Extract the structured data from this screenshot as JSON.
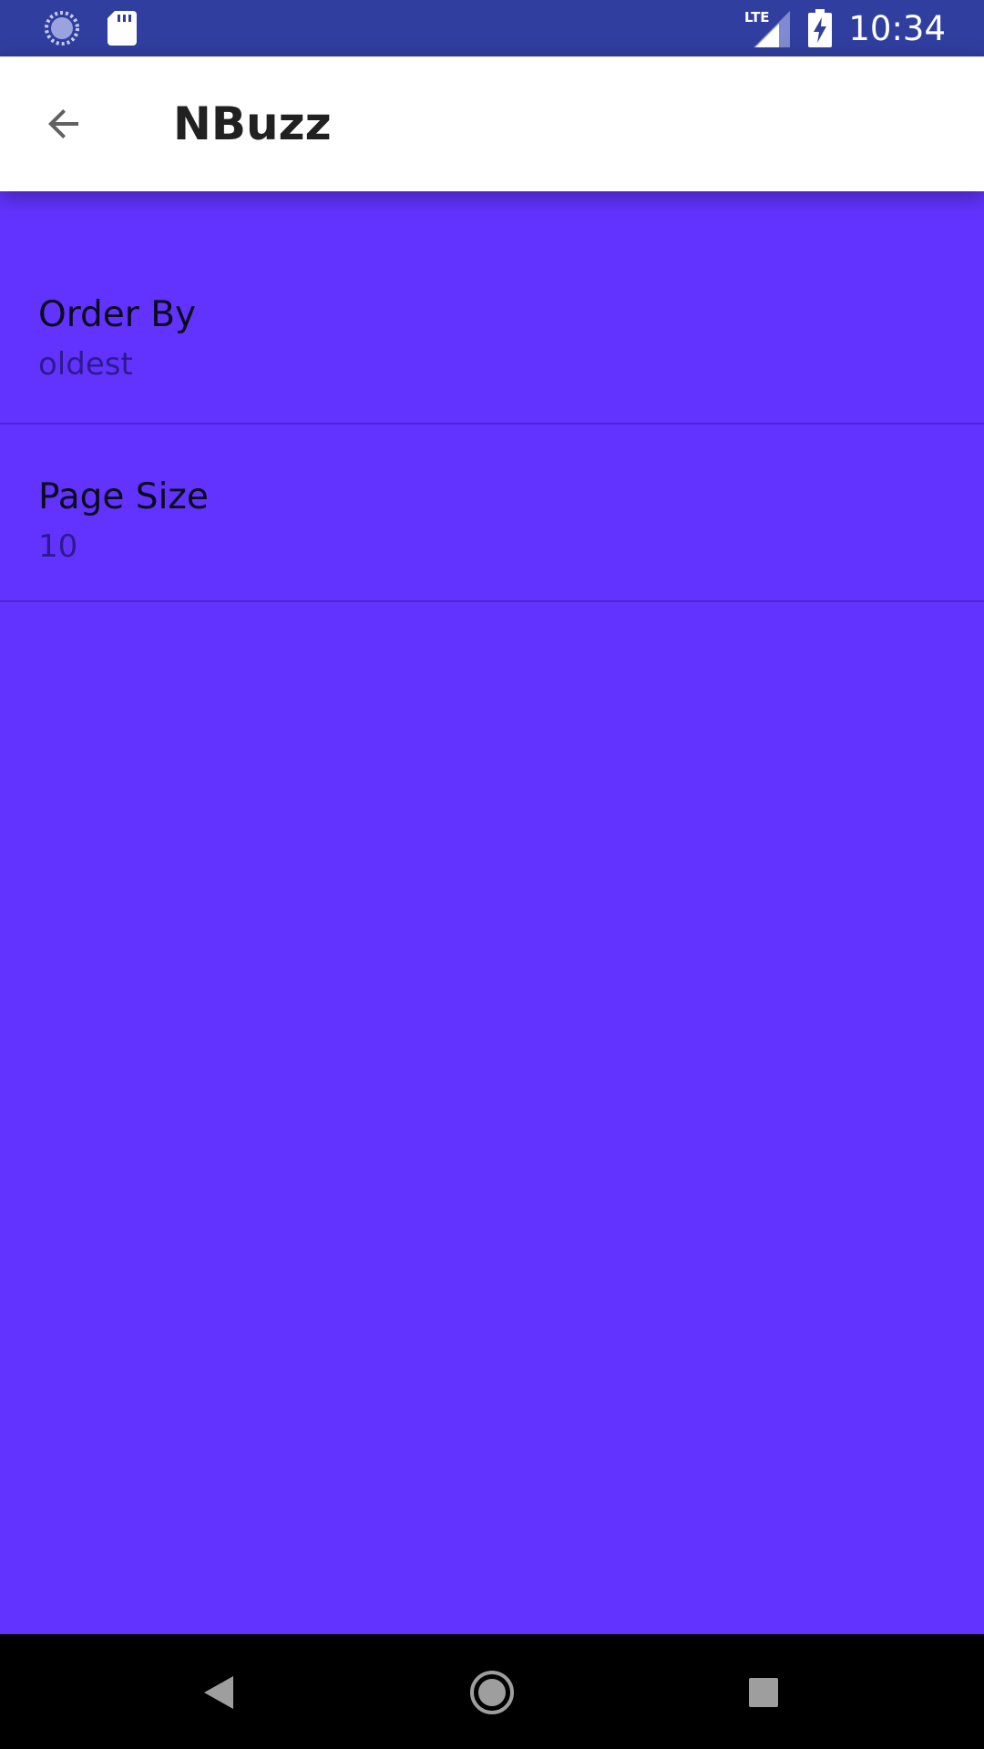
{
  "status_bar": {
    "time": "10:34",
    "network_label": "LTE",
    "icons": [
      "sync-icon",
      "sd-card-icon",
      "lte-signal-icon",
      "battery-charging-icon"
    ]
  },
  "app_bar": {
    "title": "NBuzz",
    "back_icon": "arrow-back-icon"
  },
  "preferences": [
    {
      "title": "Order By",
      "summary": "oldest"
    },
    {
      "title": "Page Size",
      "summary": "10"
    }
  ],
  "nav_bar": {
    "icons": [
      "nav-back-icon",
      "nav-home-icon",
      "nav-recents-icon"
    ]
  },
  "colors": {
    "status_bar": "#303F9F",
    "app_bar": "#FFFFFF",
    "content_background": "#6233FF",
    "nav_bar": "#000000"
  }
}
